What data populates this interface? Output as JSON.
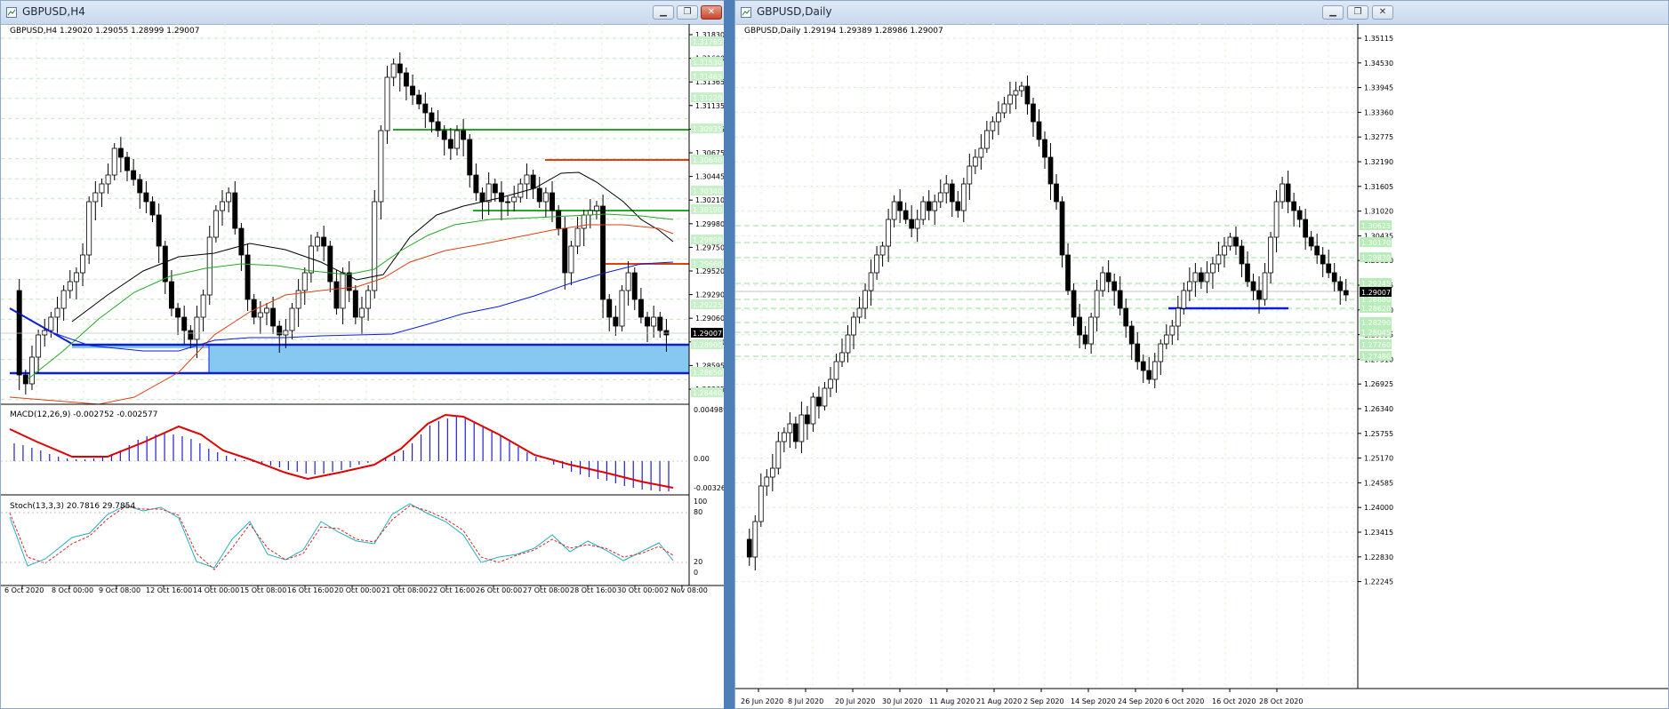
{
  "left_window": {
    "title": "GBPUSD,H4",
    "header": "GBPUSD,H4  1.29020 1.29055 1.28999 1.29007",
    "macd_label": "MACD(12,26,9) -0.002752 -0.002577",
    "stoch_label": "Stoch(13,3,3) 20.7816 29.7854",
    "price_ticks": [
      "1.31830",
      "1.31600",
      "1.31365",
      "1.31135",
      "1.30905",
      "1.30675",
      "1.30445",
      "1.30210",
      "1.29980",
      "1.29750",
      "1.29520",
      "1.29290",
      "1.29060",
      "1.28830",
      "1.28595",
      "1.28365"
    ],
    "level_labels": [
      "1.31765",
      "1.31530",
      "1.31465",
      "1.31220",
      "1.30935",
      "1.30640",
      "1.30340",
      "1.30190",
      "1.29890",
      "1.29660",
      "1.29225",
      "1.29007",
      "1.28900",
      "1.28650",
      "1.28440"
    ],
    "current_price": "1.29007",
    "macd_ticks": [
      "0.004989",
      "0.00",
      "-0.003269"
    ],
    "stoch_ticks": [
      "100",
      "80",
      "20",
      "0"
    ],
    "time_labels": [
      "6 Oct 2020",
      "8 Oct 00:00",
      "9 Oct 08:00",
      "12 Oct 16:00",
      "14 Oct 00:00",
      "15 Oct 08:00",
      "16 Oct 16:00",
      "20 Oct 00:00",
      "21 Oct 08:00",
      "22 Oct 16:00",
      "26 Oct 00:00",
      "27 Oct 08:00",
      "28 Oct 16:00",
      "30 Oct 00:00",
      "2 Nov 08:00"
    ]
  },
  "right_window": {
    "title": "GBPUSD,Daily",
    "header": "GBPUSD,Daily  1.29194 1.29389 1.28986 1.29007",
    "price_ticks": [
      "1.35115",
      "1.34530",
      "1.33945",
      "1.33360",
      "1.32775",
      "1.32190",
      "1.31605",
      "1.31020",
      "1.30435",
      "1.29850",
      "1.29265",
      "1.28680",
      "1.28095",
      "1.27510",
      "1.26925",
      "1.26340",
      "1.25755",
      "1.25170",
      "1.24585",
      "1.24000",
      "1.23415",
      "1.22830",
      "1.22245"
    ],
    "level_labels": [
      "1.30625",
      "1.30170",
      "1.29830",
      "1.29245",
      "1.28880",
      "1.28620",
      "1.28290",
      "1.28045",
      "1.27760",
      "1.27480"
    ],
    "current_price": "1.29007",
    "time_labels": [
      "26 Jun 2020",
      "8 Jul 2020",
      "20 Jul 2020",
      "30 Jul 2020",
      "11 Aug 2020",
      "21 Aug 2020",
      "2 Sep 2020",
      "14 Sep 2020",
      "24 Sep 2020",
      "6 Oct 2020",
      "16 Oct 2020",
      "28 Oct 2020"
    ]
  },
  "colors": {
    "accent_green": "#22aa22",
    "resistance_red": "#e04010",
    "support_blue": "#0a1ee0",
    "zone_fill": "#86c8f0",
    "macd_signal": "#e00000",
    "macd_hist": "#2020d0",
    "stoch_main": "#20b0c0",
    "stoch_signal": "#e02020"
  }
}
